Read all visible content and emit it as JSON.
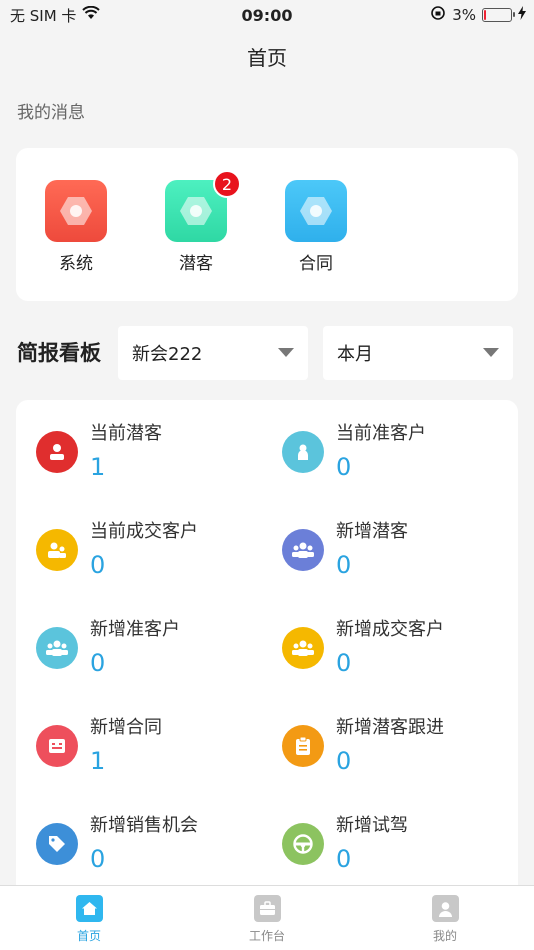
{
  "status_bar": {
    "carrier": "无 SIM 卡",
    "time": "09:00",
    "battery": "3%"
  },
  "nav": {
    "title": "首页"
  },
  "messages": {
    "section_label": "我的消息",
    "items": [
      {
        "label": "系统",
        "icon": "hexagon-icon",
        "color": "#f25a48"
      },
      {
        "label": "潜客",
        "icon": "hexagon-icon",
        "color": "#3fe0b0",
        "badge": "2"
      },
      {
        "label": "合同",
        "icon": "hexagon-icon",
        "color": "#3cb8f0"
      }
    ]
  },
  "brief": {
    "title": "简报看板",
    "store_select": "新会222",
    "period_select": "本月"
  },
  "stats": [
    {
      "label": "当前潜客",
      "value": "1",
      "icon": "person-icon",
      "color": "#e02e2e"
    },
    {
      "label": "当前准客户",
      "value": "0",
      "icon": "person-icon",
      "color": "#5bc4dc"
    },
    {
      "label": "当前成交客户",
      "value": "0",
      "icon": "people-icon",
      "color": "#f5b800"
    },
    {
      "label": "新增潜客",
      "value": "0",
      "icon": "group-icon",
      "color": "#6b7fd8"
    },
    {
      "label": "新增准客户",
      "value": "0",
      "icon": "group-icon",
      "color": "#5bc4dc"
    },
    {
      "label": "新增成交客户",
      "value": "0",
      "icon": "group-icon",
      "color": "#f5b800"
    },
    {
      "label": "新增合同",
      "value": "1",
      "icon": "contract-icon",
      "color": "#ee4f5c"
    },
    {
      "label": "新增潜客跟进",
      "value": "0",
      "icon": "clipboard-icon",
      "color": "#f39a14"
    },
    {
      "label": "新增销售机会",
      "value": "0",
      "icon": "tag-icon",
      "color": "#3d8fd8"
    },
    {
      "label": "新增试驾",
      "value": "0",
      "icon": "steering-wheel-icon",
      "color": "#8cc360"
    }
  ],
  "tabs": [
    {
      "label": "首页",
      "icon": "home-icon",
      "active": true,
      "color": "#2fb7ef"
    },
    {
      "label": "工作台",
      "icon": "briefcase-icon",
      "active": false,
      "color": "#c8c8c8"
    },
    {
      "label": "我的",
      "icon": "user-icon",
      "active": false,
      "color": "#c8c8c8"
    }
  ]
}
